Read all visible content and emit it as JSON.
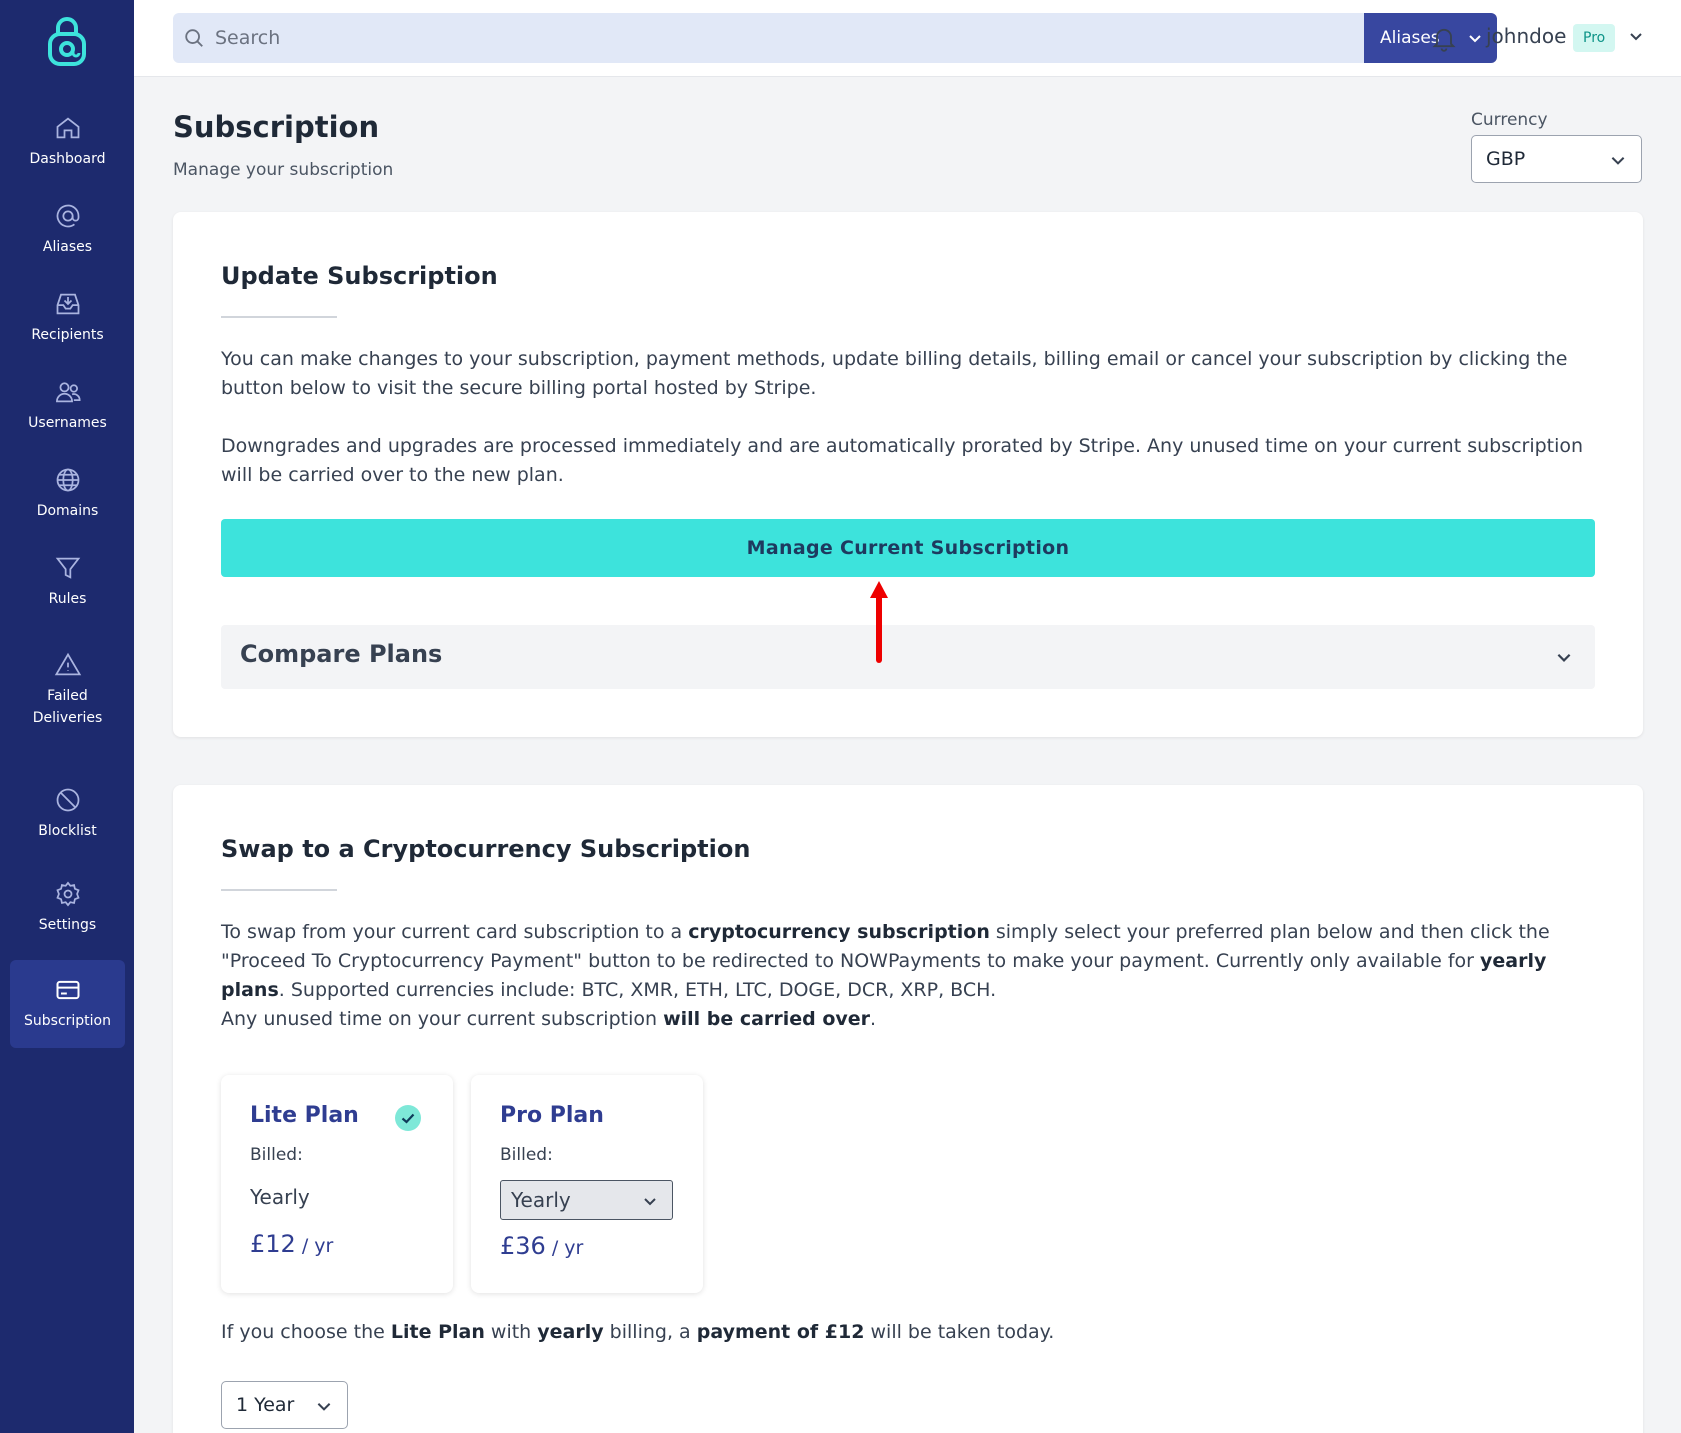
{
  "sidebar": {
    "items": [
      {
        "label": "Dashboard",
        "icon": "home-icon"
      },
      {
        "label": "Aliases",
        "icon": "at-icon"
      },
      {
        "label": "Recipients",
        "icon": "inbox-icon"
      },
      {
        "label": "Usernames",
        "icon": "users-icon"
      },
      {
        "label": "Domains",
        "icon": "globe-icon"
      },
      {
        "label": "Rules",
        "icon": "filter-icon"
      },
      {
        "label": "Failed Deliveries",
        "icon": "warning-icon"
      },
      {
        "label": "Blocklist",
        "icon": "ban-icon"
      },
      {
        "label": "Settings",
        "icon": "gear-icon"
      },
      {
        "label": "Subscription",
        "icon": "credit-card-icon",
        "active": true
      }
    ]
  },
  "header": {
    "search_placeholder": "Search",
    "search_scope": "Aliases",
    "username": "johndoe",
    "plan_badge": "Pro"
  },
  "page": {
    "title": "Subscription",
    "subtitle": "Manage your subscription",
    "currency_label": "Currency",
    "currency_value": "GBP"
  },
  "update_card": {
    "title": "Update Subscription",
    "para1": "You can make changes to your subscription, payment methods, update billing details, billing email or cancel your subscription by clicking the button below to visit the secure billing portal hosted by Stripe.",
    "para2": "Downgrades and upgrades are processed immediately and are automatically prorated by Stripe. Any unused time on your current subscription will be carried over to the new plan.",
    "manage_button": "Manage Current Subscription",
    "compare_label": "Compare Plans"
  },
  "crypto_card": {
    "title": "Swap to a Cryptocurrency Subscription",
    "p1_a": "To swap from your current card subscription to a ",
    "p1_b": "cryptocurrency subscription",
    "p1_c": " simply select your preferred plan below and then click the \"Proceed To Cryptocurrency Payment\" button to be redirected to NOWPayments to make your payment. Currently only available for ",
    "p1_d": "yearly plans",
    "p1_e": ". Supported currencies include: BTC, XMR, ETH, LTC, DOGE, DCR, XRP, BCH.",
    "p2_a": "Any unused time on your current subscription ",
    "p2_b": "will be carried over",
    "p2_c": ".",
    "plans": [
      {
        "name": "Lite Plan",
        "billed_label": "Billed:",
        "billing": "Yearly",
        "price": "£12",
        "per": " / yr",
        "selected": true
      },
      {
        "name": "Pro Plan",
        "billed_label": "Billed:",
        "billing": "Yearly",
        "price": "£36",
        "per": " / yr",
        "selected": false
      }
    ],
    "summary_a": "If you choose the ",
    "summary_b": "Lite Plan",
    "summary_c": " with ",
    "summary_d": "yearly",
    "summary_e": " billing, a ",
    "summary_f": "payment of £12",
    "summary_g": " will be taken today.",
    "years_value": "1 Year"
  },
  "colors": {
    "sidebar_bg": "#1d2a6e",
    "accent": "#3de3dc",
    "primary": "#3847a0",
    "plan_text": "#2f3d91"
  }
}
